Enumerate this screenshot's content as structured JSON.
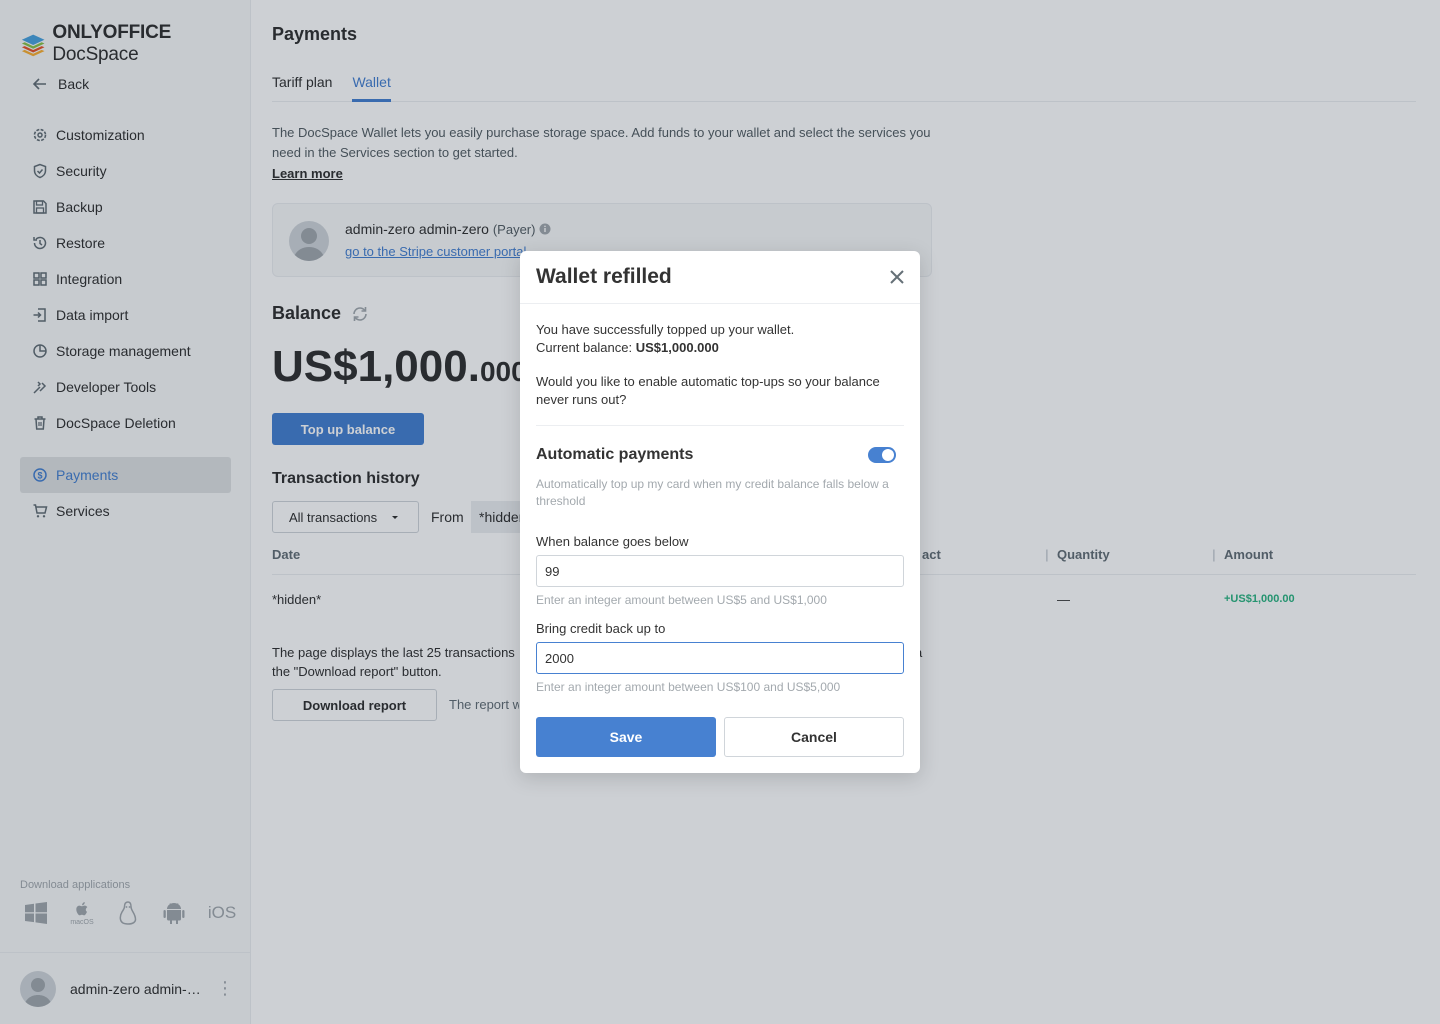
{
  "app": {
    "logo_brand": "ONLYOFFICE",
    "logo_product": "DocSpace",
    "colors": {
      "accent": "#4781d1",
      "success": "#2db482",
      "text": "#333333",
      "muted": "#a3a9ae"
    }
  },
  "sidebar": {
    "back_label": "Back",
    "items": [
      {
        "label": "Customization",
        "icon": "gear-icon"
      },
      {
        "label": "Security",
        "icon": "shield-icon"
      },
      {
        "label": "Backup",
        "icon": "floppy-icon"
      },
      {
        "label": "Restore",
        "icon": "restore-icon"
      },
      {
        "label": "Integration",
        "icon": "grid-icon"
      },
      {
        "label": "Data import",
        "icon": "import-icon"
      },
      {
        "label": "Storage management",
        "icon": "pie-chart-icon"
      },
      {
        "label": "Developer Tools",
        "icon": "developer-tools-icon"
      },
      {
        "label": "DocSpace Deletion",
        "icon": "trash-icon"
      },
      {
        "label": "Payments",
        "icon": "dollar-icon",
        "active": true
      },
      {
        "label": "Services",
        "icon": "cart-icon"
      }
    ],
    "download_title": "Download applications",
    "download_macos_label": "macOS",
    "download_ios_label": "iOS",
    "profile_name": "admin-zero admin-zero"
  },
  "main": {
    "title": "Payments",
    "tabs": [
      {
        "label": "Tariff plan",
        "active": false
      },
      {
        "label": "Wallet",
        "active": true
      }
    ],
    "description": "The DocSpace Wallet lets you easily purchase storage space. Add funds to your wallet and select the services you need in the Services section to get started.",
    "learn_more": "Learn more",
    "payer": {
      "name": "admin-zero admin-zero",
      "role": "(Payer)",
      "link": "go to the Stripe customer portal"
    },
    "balance_title": "Balance",
    "balance_main": "US$1,000.",
    "balance_decimals": "000",
    "top_up_label": "Top up balance",
    "transaction_title": "Transaction history",
    "filter_value": "All transactions",
    "from_label": "From",
    "from_value": "*hidden*",
    "table": {
      "columns": [
        "Date",
        "act",
        "Quantity",
        "Amount"
      ],
      "rows": [
        {
          "date": "*hidden*",
          "quantity": "—",
          "amount": "+US$1,000.00"
        }
      ]
    },
    "note_line1": "The page displays the last 25 transactions",
    "note_tail": "a",
    "note_line2": "the \"Download report\" button.",
    "download_report_label": "Download report",
    "report_note": "The report w"
  },
  "modal": {
    "title": "Wallet refilled",
    "message_line1": "You have successfully topped up your wallet.",
    "current_balance_label": "Current balance:",
    "current_balance_value": "US$1,000.000",
    "question": "Would you like to enable automatic top-ups so your balance never runs out?",
    "auto_title": "Automatic payments",
    "auto_enabled": true,
    "auto_desc": "Automatically top up my card when my credit balance falls below a threshold",
    "threshold_label": "When balance goes below",
    "threshold_value": "99",
    "threshold_hint": "Enter an integer amount between US$5 and US$1,000",
    "topup_label": "Bring credit back up to",
    "topup_value": "2000",
    "topup_hint": "Enter an integer amount between US$100 and US$5,000",
    "save_label": "Save",
    "cancel_label": "Cancel"
  }
}
